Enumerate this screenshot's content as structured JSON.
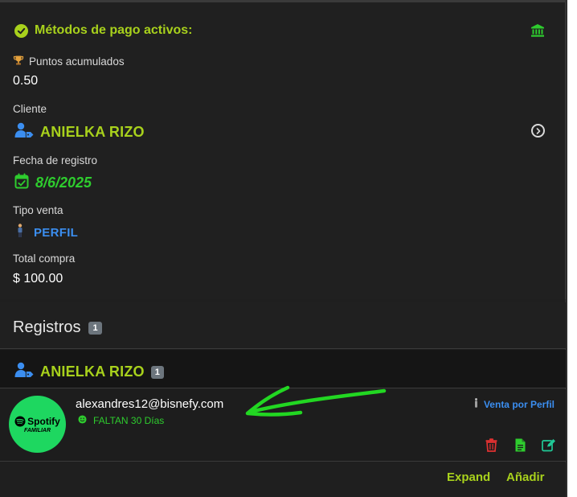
{
  "summary": {
    "title": "Métodos de pago activos:",
    "points_label": "Puntos acumulados",
    "points_value": "0.50",
    "client_label": "Cliente",
    "client_name": "ANIELKA RIZO",
    "date_label": "Fecha de registro",
    "date_value": "8/6/2025",
    "type_label": "Tipo venta",
    "type_value": "PERFIL",
    "total_label": "Total compra",
    "total_value": "$ 100.00"
  },
  "registros": {
    "heading": "Registros",
    "count": "1"
  },
  "client_group": {
    "name": "ANIELKA RIZO",
    "count": "1"
  },
  "record": {
    "logo_brand": "Spotify",
    "logo_plan": "FAMILIAR",
    "email": "alexandres12@bisnefy.com",
    "remaining": "FALTAN 30 Días",
    "sale_type": "Venta por Perfil"
  },
  "footer": {
    "expand_label": "Expand",
    "add_label": "Añadir"
  },
  "colors": {
    "accent_lime": "#a8d11c",
    "accent_green": "#2ecc2e",
    "accent_blue": "#3b8ef0",
    "delete_red": "#e03131",
    "doc_green": "#2ecc2e",
    "edit_teal": "#20c997",
    "spotify_green": "#1ed760"
  },
  "icons": [
    "check-circle-icon",
    "bank-icon",
    "trophy-icon",
    "user-tag-icon",
    "chevron-right-circle-icon",
    "calendar-check-icon",
    "person-icon",
    "spotify-icon",
    "smile-icon",
    "trash-icon",
    "file-icon",
    "edit-icon",
    "arrow-annotation"
  ]
}
